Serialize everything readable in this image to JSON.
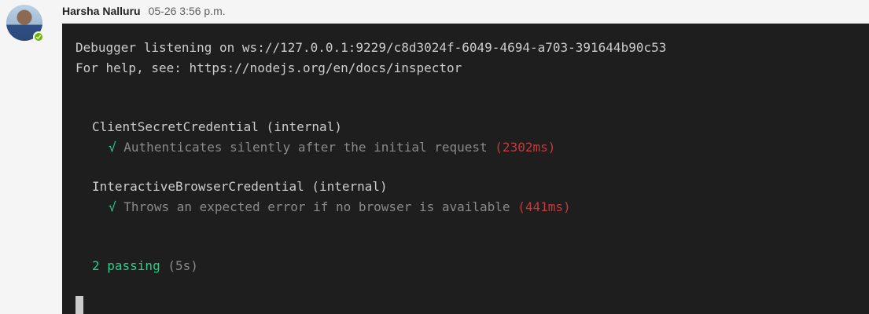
{
  "message": {
    "author": "Harsha Nalluru",
    "timestamp": "05-26 3:56 p.m.",
    "presence_color": "#6bb700"
  },
  "terminal": {
    "debugger_line": "Debugger listening on ws://127.0.0.1:9229/c8d3024f-6049-4694-a703-391644b90c53",
    "help_line": "For help, see: https://nodejs.org/en/docs/inspector",
    "suites": [
      {
        "name": "ClientSecretCredential (internal)",
        "test": {
          "check": "√",
          "title": "Authenticates silently after the initial request",
          "duration": "(2302ms)"
        }
      },
      {
        "name": "InteractiveBrowserCredential (internal)",
        "test": {
          "check": "√",
          "title": "Throws an expected error if no browser is available",
          "duration": "(441ms)"
        }
      }
    ],
    "summary": {
      "passing": "2 passing",
      "time": "(5s)"
    },
    "colors": {
      "background": "#1e1e1e",
      "pass": "#23d18b",
      "slow": "#c33b3b"
    }
  }
}
